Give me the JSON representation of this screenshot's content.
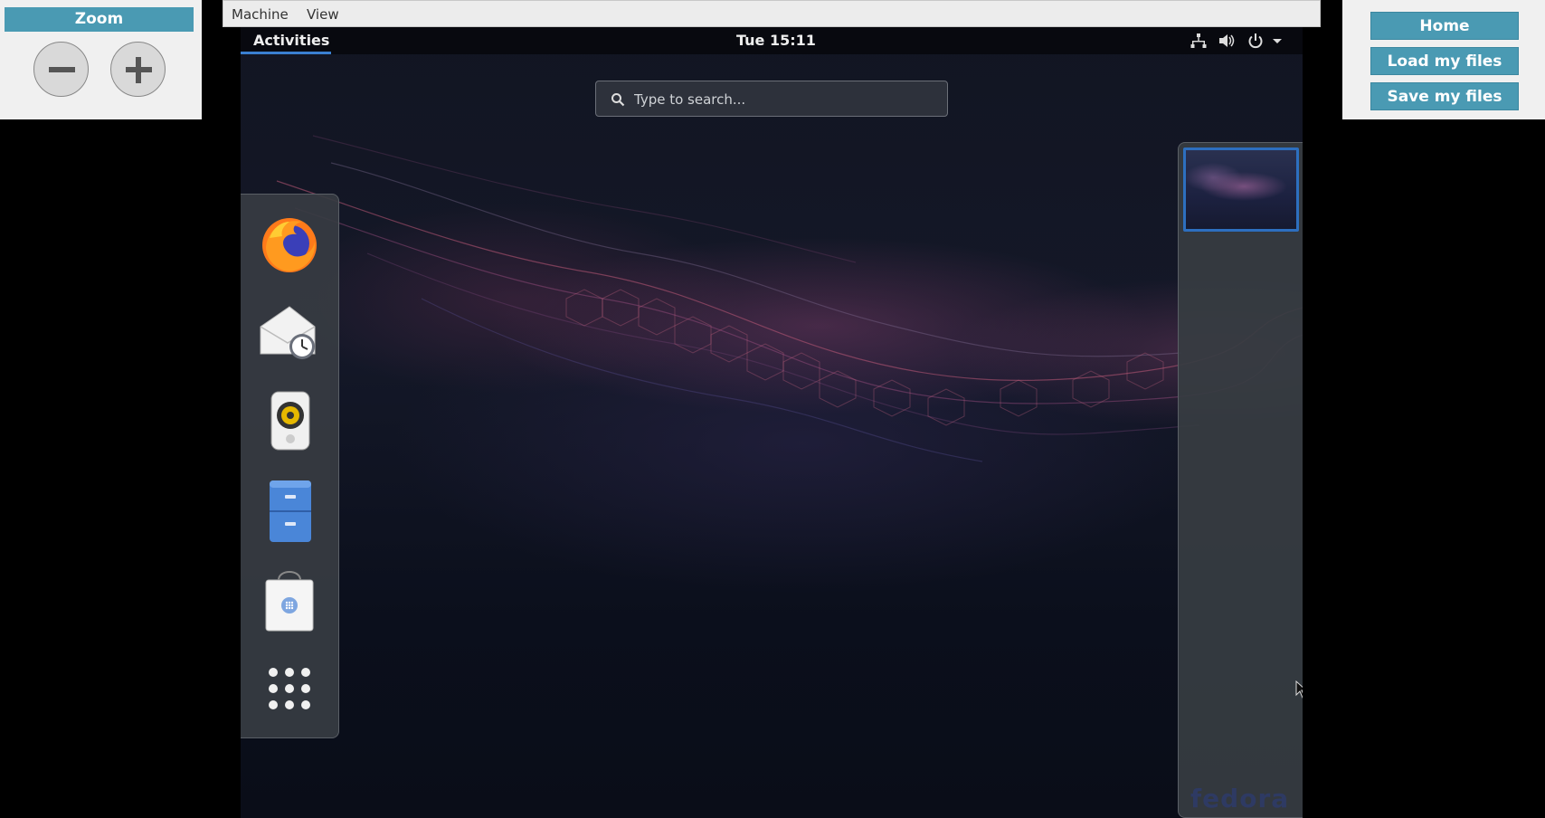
{
  "zoom_panel": {
    "title": "Zoom"
  },
  "right_panel": {
    "home_label": "Home",
    "load_label": "Load my files",
    "save_label": "Save my files"
  },
  "vm_menu": {
    "items": [
      "Machine",
      "View"
    ]
  },
  "gnome": {
    "activities_label": "Activities",
    "clock": "Tue 15:11",
    "search_placeholder": "Type to search...",
    "tray_icons": [
      "network-icon",
      "volume-icon",
      "power-icon",
      "chevron-down-icon"
    ],
    "dock_apps": [
      "Firefox",
      "Evolution",
      "Rhythmbox",
      "Files",
      "Software",
      "Show Applications"
    ],
    "brand": "fedora"
  },
  "colors": {
    "panel_button": "#4a9ab3",
    "workspace_highlight": "#2d6fbf"
  }
}
